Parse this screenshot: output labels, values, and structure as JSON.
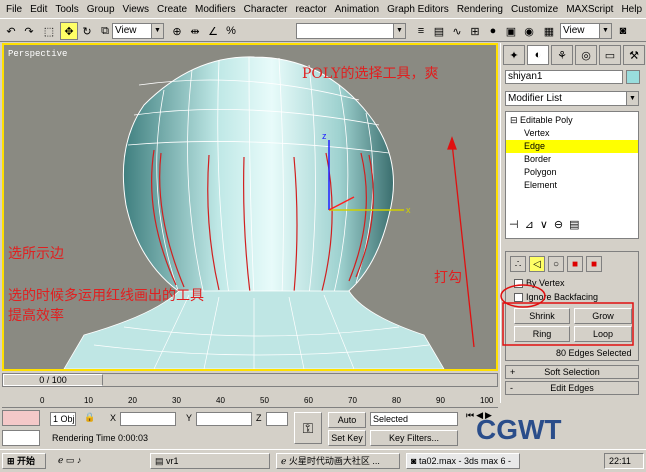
{
  "menu": [
    "File",
    "Edit",
    "Tools",
    "Group",
    "Views",
    "Create",
    "Modifiers",
    "Character",
    "reactor",
    "Animation",
    "Graph Editors",
    "Rendering",
    "Customize",
    "MAXScript",
    "Help"
  ],
  "toolbar": {
    "refcoord": "View",
    "selset": "",
    "view2": "View"
  },
  "viewport": {
    "label": "Perspective",
    "annotation_title": "POLY的选择工具，爽",
    "annotation_select": "选所示边",
    "annotation_tip_line1": "选的时候多运用红线画出的工具",
    "annotation_tip_line2": "提高效率",
    "annotation_check": "打勾"
  },
  "panel": {
    "object_name": "shiyan1",
    "modifier_list": "Modifier List",
    "stack": [
      "Editable Poly",
      "Vertex",
      "Edge",
      "Border",
      "Polygon",
      "Element"
    ],
    "selected_index": 2,
    "by_vertex": "By Vertex",
    "ignore_backfacing": "Ignore Backfacing",
    "shrink": "Shrink",
    "grow": "Grow",
    "ring": "Ring",
    "loop": "Loop",
    "edges_selected": "80 Edges Selected",
    "soft_selection": "Soft Selection",
    "edit_edges": "Edit Edges"
  },
  "timeline": {
    "slider": "0 / 100",
    "ticks": [
      "0",
      "10",
      "20",
      "30",
      "40",
      "50",
      "60",
      "70",
      "80",
      "90",
      "100"
    ]
  },
  "status": {
    "objcount": "1 Obj",
    "x_label": "X",
    "y_label": "Y",
    "z_label": "Z",
    "auto_key": "Auto Key",
    "selected": "Selected",
    "set_key": "Set Key",
    "key_filters": "Key Filters...",
    "render_time": "Rendering Time  0:00:03"
  },
  "taskbar": {
    "start": "开始",
    "task1": "vr1",
    "task2": "火星时代动画大社区 ...",
    "task3": "ta02.max - 3ds max 6 -",
    "clock": "22:11"
  },
  "watermark": "CGWT"
}
